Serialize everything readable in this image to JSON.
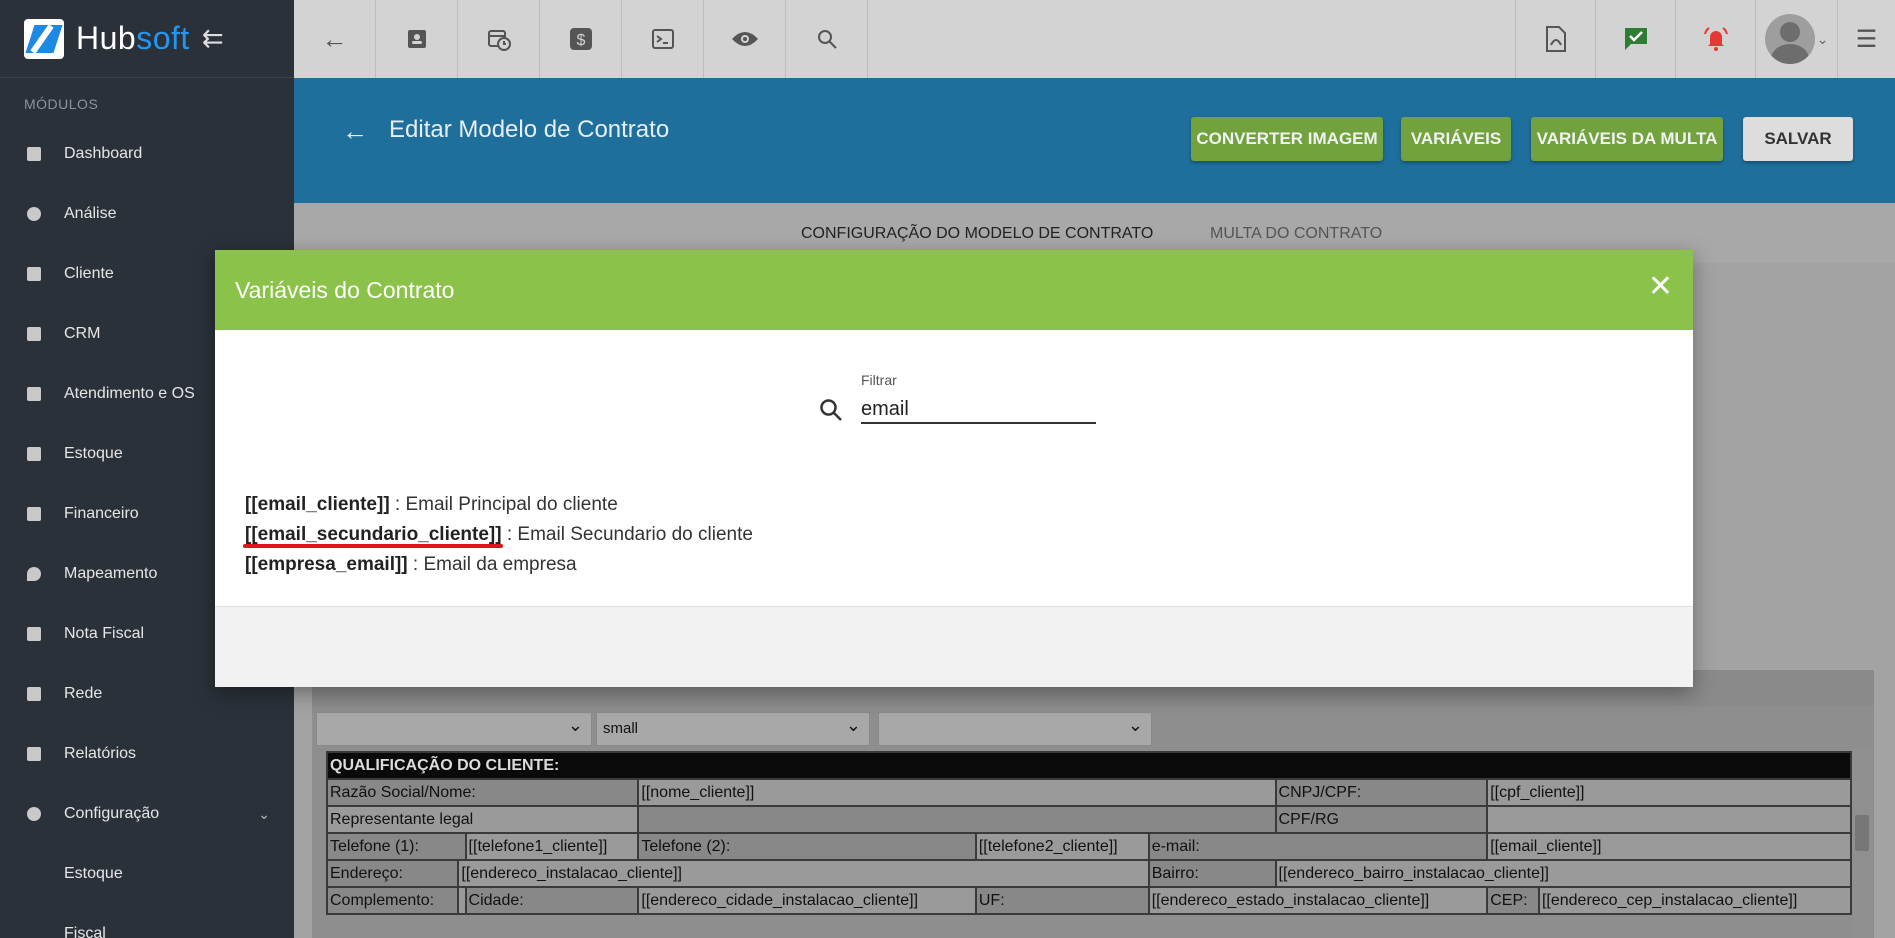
{
  "brand": {
    "name_part1": "Hub",
    "name_part2": "soft"
  },
  "sidebar": {
    "section_label": "MÓDULOS",
    "items": [
      {
        "label": "Dashboard",
        "icon": "dashboard-icon"
      },
      {
        "label": "Análise",
        "icon": "pie-chart-icon"
      },
      {
        "label": "Cliente",
        "icon": "contact-card-icon"
      },
      {
        "label": "CRM",
        "icon": "kanban-icon"
      },
      {
        "label": "Atendimento e OS",
        "icon": "calendar-clock-icon"
      },
      {
        "label": "Estoque",
        "icon": "box-icon"
      },
      {
        "label": "Financeiro",
        "icon": "money-icon"
      },
      {
        "label": "Mapeamento",
        "icon": "map-pin-icon"
      },
      {
        "label": "Nota Fiscal",
        "icon": "receipt-icon"
      },
      {
        "label": "Rede",
        "icon": "server-icon"
      },
      {
        "label": "Relatórios",
        "icon": "report-icon"
      },
      {
        "label": "Configuração",
        "icon": "gear-icon"
      }
    ],
    "sub_items": [
      {
        "label": "Estoque"
      },
      {
        "label": "Fiscal"
      }
    ]
  },
  "header": {
    "title": "Editar Modelo de Contrato",
    "buttons": {
      "converter": "CONVERTER IMAGEM",
      "variaveis": "VARIÁVEIS",
      "variaveis_multa": "VARIÁVEIS DA MULTA",
      "salvar": "SALVAR"
    }
  },
  "tabs": {
    "config": "CONFIGURAÇÃO DO MODELO DE CONTRATO",
    "multa": "MULTA DO CONTRATO"
  },
  "modal": {
    "title": "Variáveis do Contrato",
    "filter_label": "Filtrar",
    "filter_value": "email",
    "variables": [
      {
        "code": "[[email_cliente]]",
        "desc": " : Email Principal do cliente"
      },
      {
        "code": "[[email_secundario_cliente]]",
        "desc": " : Email Secundario do cliente"
      },
      {
        "code": "[[empresa_email]]",
        "desc": " : Email da empresa"
      }
    ]
  },
  "editor": {
    "font_size_select": "small",
    "table": {
      "heading": "QUALIFICAÇÃO DO CLIENTE:",
      "razao_label": "Razão Social/Nome:",
      "razao_value": "[[nome_cliente]]",
      "cnpj_label": "CNPJ/CPF:",
      "cnpj_value": "[[cpf_cliente]]",
      "representante_label": "Representante legal",
      "cpfrg_label": "CPF/RG",
      "tel1_label": "Telefone (1):",
      "tel1_value": "[[telefone1_cliente]]",
      "tel2_label": "Telefone (2):",
      "tel2_value": "[[telefone2_cliente]]",
      "email_label": "e-mail:",
      "email_value": "[[email_cliente]]",
      "endereco_label": "Endereço:",
      "endereco_value": "[[endereco_instalacao_cliente]]",
      "bairro_label": "Bairro:",
      "bairro_value": "[[endereco_bairro_instalacao_cliente]]",
      "complemento_label": "Complemento:",
      "cidade_label": "Cidade:",
      "cidade_value": "[[endereco_cidade_instalacao_cliente]]",
      "uf_label": "UF:",
      "uf_value": "[[endereco_estado_instalacao_cliente]]",
      "cep_label": "CEP:",
      "cep_value": "[[endereco_cep_instalacao_cliente]]"
    }
  },
  "colors": {
    "sidebar": "#2b3139",
    "header_banner": "#1f6f9c",
    "modal_header": "#8bc24a",
    "green_button": "#72a23e",
    "brand_blue": "#2196f3",
    "highlight_red": "#e0141a"
  }
}
